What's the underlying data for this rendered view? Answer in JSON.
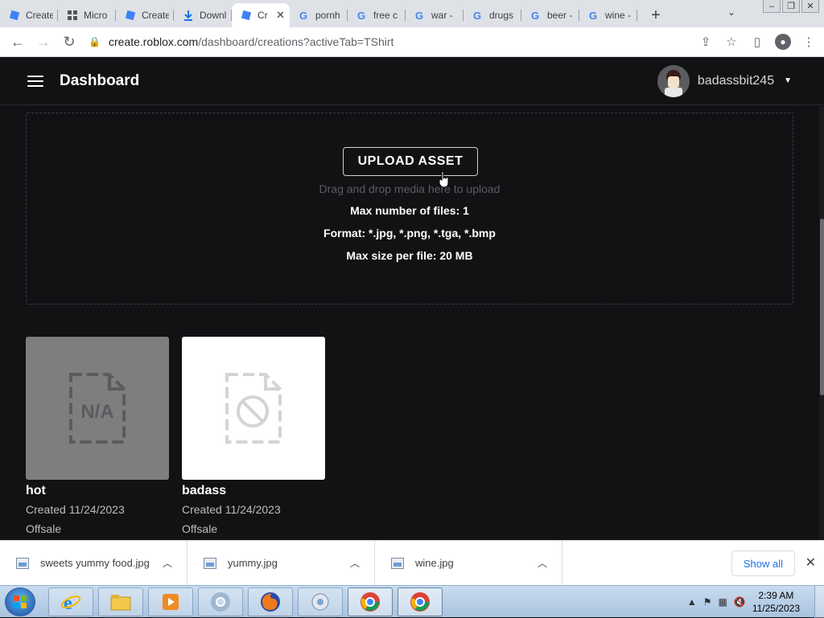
{
  "tabs": [
    {
      "title": "Create",
      "icon": "roblox-icon"
    },
    {
      "title": "Micro",
      "icon": "microsoft-icon"
    },
    {
      "title": "Create",
      "icon": "roblox-icon"
    },
    {
      "title": "Downl",
      "icon": "download-icon"
    },
    {
      "title": "Cr",
      "icon": "roblox-icon",
      "active": true
    },
    {
      "title": "pornh",
      "icon": "google-icon"
    },
    {
      "title": "free c",
      "icon": "google-icon"
    },
    {
      "title": "war -",
      "icon": "google-icon"
    },
    {
      "title": "drugs",
      "icon": "google-icon"
    },
    {
      "title": "beer -",
      "icon": "google-icon"
    },
    {
      "title": "wine -",
      "icon": "google-icon"
    }
  ],
  "address": {
    "host": "create.roblox.com",
    "path": "/dashboard/creations?activeTab=TShirt"
  },
  "header": {
    "title": "Dashboard",
    "username": "badassbit245"
  },
  "upload": {
    "button_label": "UPLOAD ASSET",
    "hint": "Drag and drop media here to upload",
    "max_files": "Max number of files: 1",
    "formats": "Format: *.jpg, *.png, *.tga, *.bmp",
    "max_size": "Max size per file: 20 MB"
  },
  "creations": [
    {
      "name": "hot",
      "created": "Created 11/24/2023",
      "status": "Offsale",
      "thumb": "na-file-icon"
    },
    {
      "name": "badass",
      "created": "Created 11/24/2023",
      "status": "Offsale",
      "thumb": "blocked-file-icon"
    }
  ],
  "downloads": {
    "items": [
      "sweets yummy food.jpg",
      "yummy.jpg",
      "wine.jpg"
    ],
    "show_all": "Show all"
  },
  "taskbar": {
    "time": "2:39 AM",
    "date": "11/25/2023"
  },
  "colors": {
    "background": "#111214",
    "link": "#1a73e8"
  }
}
